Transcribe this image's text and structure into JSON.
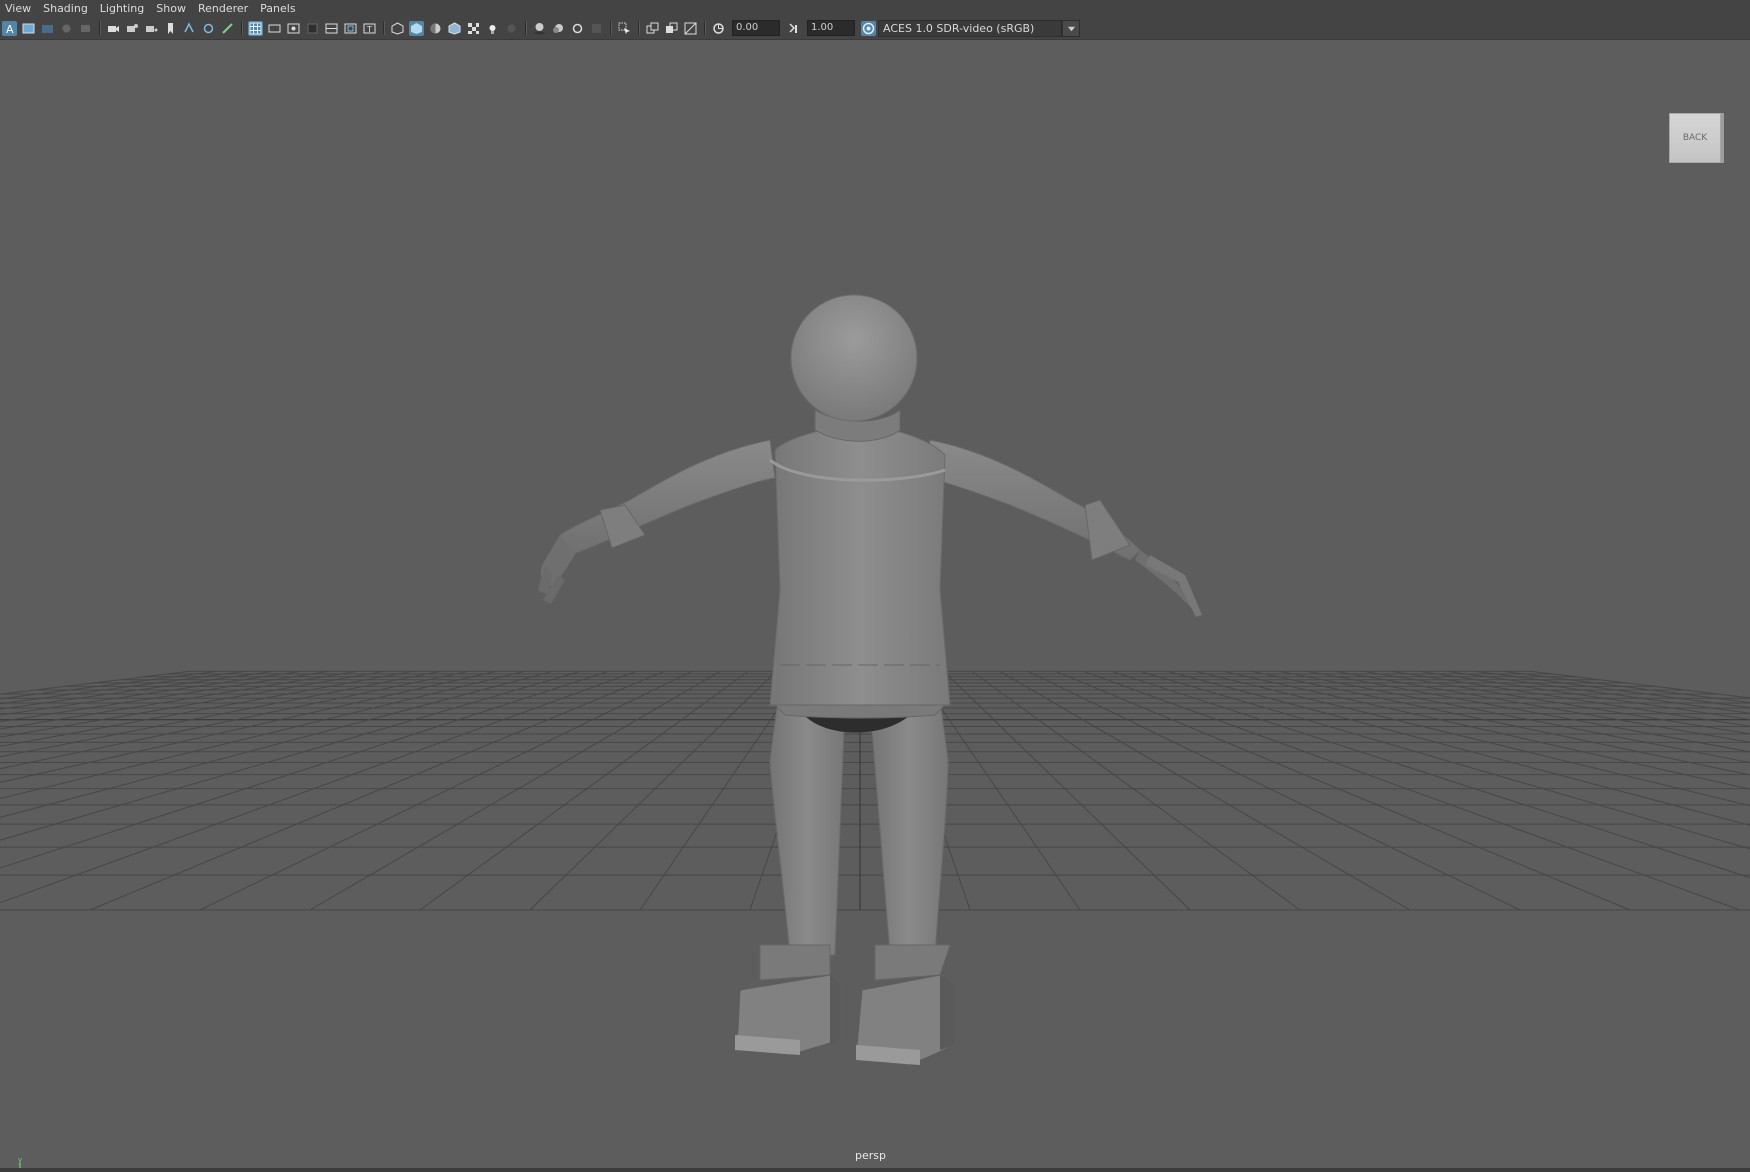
{
  "menu": [
    "View",
    "Shading",
    "Lighting",
    "Show",
    "Renderer",
    "Panels"
  ],
  "toolbar": {
    "exposure": "0.00",
    "gamma": "1.00",
    "color_space": "ACES 1.0 SDR-video (sRGB)"
  },
  "viewport": {
    "camera": "persp",
    "viewcube_face": "BACK"
  },
  "colors": {
    "background": "#5d5d5d",
    "panel": "#444444",
    "accent": "#5285a6",
    "grid": "#3a3a3a"
  },
  "icons": [
    "select-camera-icon",
    "camera-attributes-icon",
    "bookmarks-icon",
    "image-plane-icon",
    "grid-icon",
    "film-gate-icon",
    "wireframe-icon",
    "smooth-shade-icon",
    "textured-icon",
    "lights-icon",
    "shadows-icon",
    "xray-icon",
    "isolate-select-icon",
    "exposure-icon",
    "gamma-icon",
    "color-management-icon"
  ]
}
